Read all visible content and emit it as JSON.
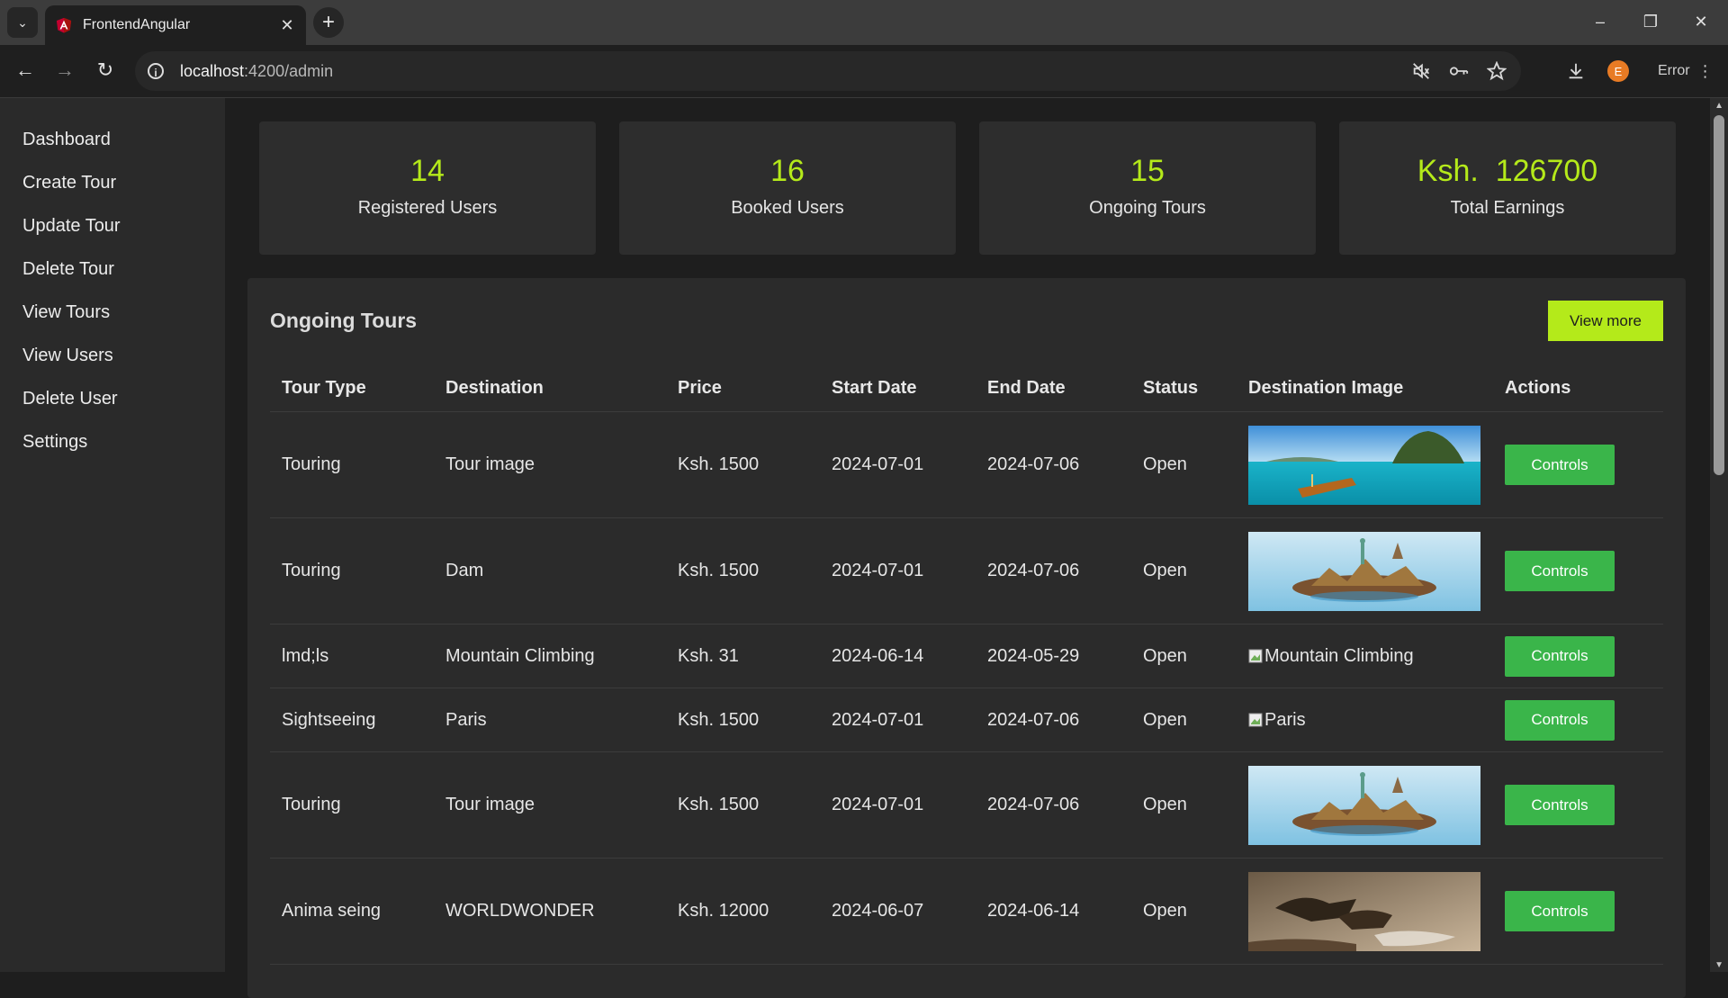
{
  "browser": {
    "tab_title": "FrontendAngular",
    "url_host": "localhost",
    "url_path": ":4200/admin",
    "profile_initial": "E",
    "error_label": "Error"
  },
  "sidebar": {
    "items": [
      {
        "label": "Dashboard"
      },
      {
        "label": "Create Tour"
      },
      {
        "label": "Update Tour"
      },
      {
        "label": "Delete Tour"
      },
      {
        "label": "View Tours"
      },
      {
        "label": "View Users"
      },
      {
        "label": "Delete User"
      },
      {
        "label": "Settings"
      }
    ]
  },
  "stats": [
    {
      "value": "14",
      "label": "Registered Users"
    },
    {
      "value": "16",
      "label": "Booked Users"
    },
    {
      "value": "15",
      "label": "Ongoing Tours"
    },
    {
      "value": "Ksh.  126700",
      "label": "Total Earnings"
    }
  ],
  "ongoing": {
    "title": "Ongoing Tours",
    "view_more_label": "View more",
    "columns": [
      "Tour Type",
      "Destination",
      "Price",
      "Start Date",
      "End Date",
      "Status",
      "Destination Image",
      "Actions"
    ],
    "rows": [
      {
        "type": "Touring",
        "destination": "Tour image",
        "price": "Ksh. 1500",
        "start": "2024-07-01",
        "end": "2024-07-06",
        "status": "Open",
        "image": "beach-boat",
        "image_alt": "",
        "action": "Controls"
      },
      {
        "type": "Touring",
        "destination": "Dam",
        "price": "Ksh. 1500",
        "start": "2024-07-01",
        "end": "2024-07-06",
        "status": "Open",
        "image": "world-landmarks",
        "image_alt": "",
        "action": "Controls"
      },
      {
        "type": "lmd;ls",
        "destination": "Mountain Climbing",
        "price": "Ksh. 31",
        "start": "2024-06-14",
        "end": "2024-05-29",
        "status": "Open",
        "image": "broken",
        "image_alt": "Mountain Climbing",
        "action": "Controls"
      },
      {
        "type": "Sightseeing",
        "destination": "Paris",
        "price": "Ksh. 1500",
        "start": "2024-07-01",
        "end": "2024-07-06",
        "status": "Open",
        "image": "broken",
        "image_alt": "Paris",
        "action": "Controls"
      },
      {
        "type": "Touring",
        "destination": "Tour image",
        "price": "Ksh. 1500",
        "start": "2024-07-01",
        "end": "2024-07-06",
        "status": "Open",
        "image": "world-landmarks",
        "image_alt": "",
        "action": "Controls"
      },
      {
        "type": "Anima seing",
        "destination": "WORLDWONDER",
        "price": "Ksh. 12000",
        "start": "2024-06-07",
        "end": "2024-06-14",
        "status": "Open",
        "image": "wildebeest-river",
        "image_alt": "",
        "action": "Controls"
      }
    ]
  },
  "colors": {
    "accent": "#b5ea1a",
    "button_green": "#3ab54a",
    "sidebar_bg": "#2a2a2a",
    "panel_bg": "#2b2b2b"
  }
}
